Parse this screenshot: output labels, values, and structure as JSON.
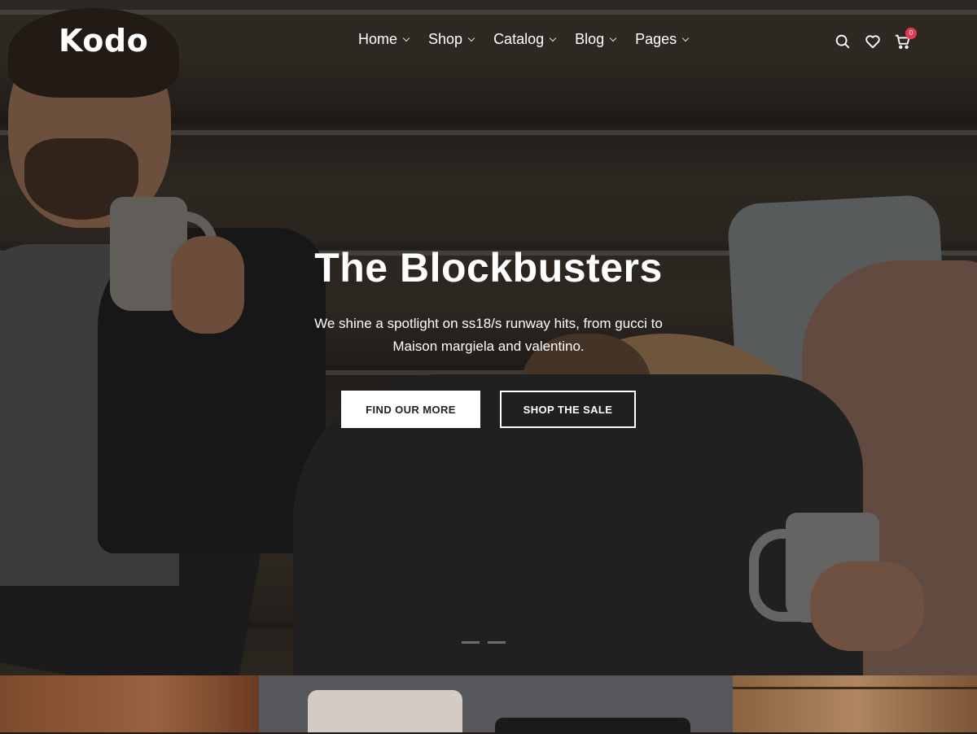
{
  "brand": {
    "logo": "Kodo"
  },
  "nav": {
    "items": [
      {
        "label": "Home"
      },
      {
        "label": "Shop"
      },
      {
        "label": "Catalog"
      },
      {
        "label": "Blog"
      },
      {
        "label": "Pages"
      }
    ]
  },
  "header_icons": {
    "search": "search-icon",
    "wishlist": "heart-icon",
    "cart": "cart-icon",
    "cart_count": "0"
  },
  "hero": {
    "title": "The Blockbusters",
    "subtitle": "We shine a spotlight on ss18/s runway hits, from gucci to Maison margiela and valentino.",
    "primary_button": "FIND OUR MORE",
    "secondary_button": "SHOP THE SALE"
  },
  "colors": {
    "badge": "#e23a53",
    "text": "#ffffff",
    "primary_button_bg": "#ffffff",
    "primary_button_text": "#222222"
  }
}
